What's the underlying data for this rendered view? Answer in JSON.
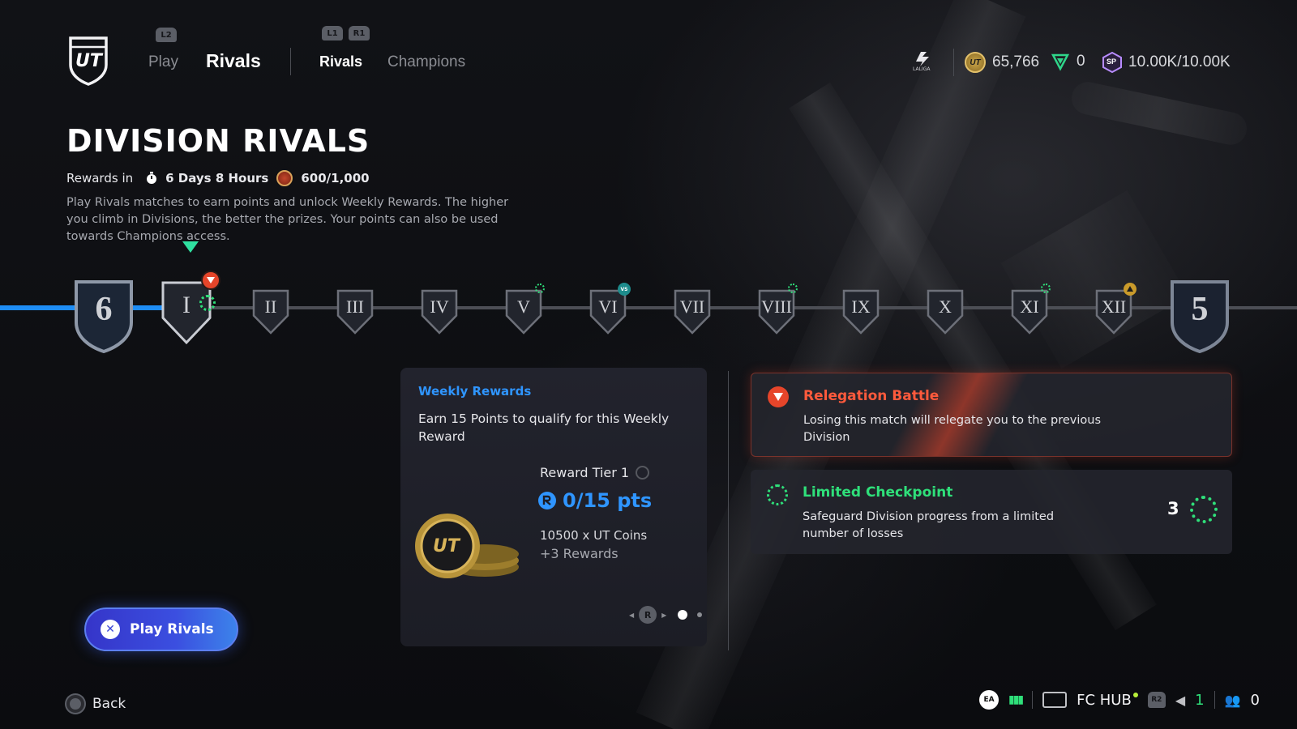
{
  "header": {
    "l2_label": "L2",
    "l1_label": "L1",
    "r1_label": "R1",
    "logo_text": "UT",
    "nav_play": "Play",
    "nav_rivals": "Rivals",
    "subnav_rivals": "Rivals",
    "subnav_champions": "Champions",
    "league_label": "LALIGA",
    "coins": "65,766",
    "points": "0",
    "sp": "10.00K/10.00K",
    "sp_icon_label": "SP"
  },
  "title": "DIVISION RIVALS",
  "rewards_in_label": "Rewards in",
  "rewards_time": "6 Days 8 Hours",
  "rewards_progress": "600/1,000",
  "description": "Play Rivals matches to earn points and unlock Weekly Rewards. The higher you climb in Divisions, the better the prizes. Your points can also be used towards Champions access.",
  "timeline": {
    "current_division": "6",
    "next_division": "5",
    "steps": [
      "I",
      "II",
      "III",
      "IV",
      "V",
      "VI",
      "VII",
      "VIII",
      "IX",
      "X",
      "XI",
      "XII"
    ],
    "vs_badge": "VS"
  },
  "weekly": {
    "heading": "Weekly Rewards",
    "body": "Earn 15 Points to qualify for this Weekly Reward",
    "tier": "Reward Tier 1",
    "pts": "0/15 pts",
    "item": "10500 x UT Coins",
    "more": "+3 Rewards",
    "pager_button": "R"
  },
  "relegation": {
    "title": "Relegation Battle",
    "body": "Losing this match will relegate you to the previous Division"
  },
  "checkpoint": {
    "title": "Limited Checkpoint",
    "body": "Safeguard Division progress from a limited number of losses",
    "count": "3"
  },
  "play_button": "Play Rivals",
  "back_label": "Back",
  "footer": {
    "ea_label": "EA",
    "fc_hub": "FC HUB",
    "r2_label": "R2",
    "count_a": "1",
    "count_b": "0"
  },
  "colors": {
    "accent_blue": "#1e8df5",
    "relegation_red": "#e6452a",
    "checkpoint_green": "#2fe07a"
  }
}
